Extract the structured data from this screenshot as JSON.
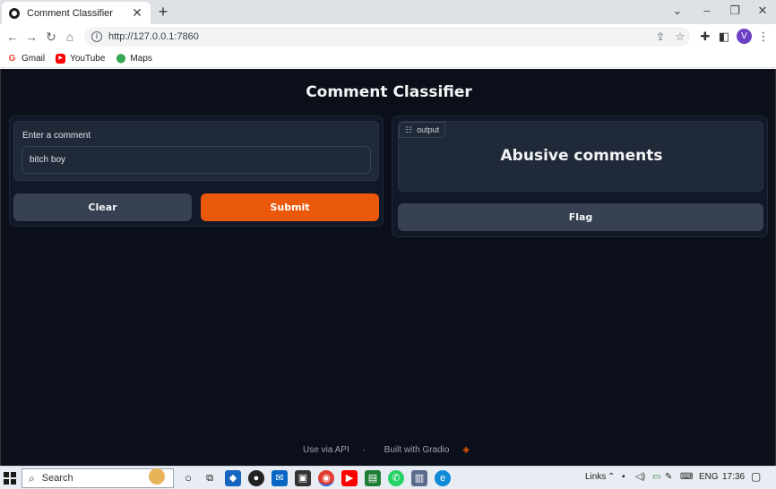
{
  "browser": {
    "tab_title": "Comment Classifier",
    "tab_close": "✕",
    "new_tab": "+",
    "url": "http://127.0.0.1:7860",
    "profile_initial": "V",
    "bookmarks": [
      {
        "label": "Gmail",
        "icon": "gmail-icon"
      },
      {
        "label": "YouTube",
        "icon": "youtube-icon"
      },
      {
        "label": "Maps",
        "icon": "maps-icon"
      }
    ]
  },
  "app": {
    "title": "Comment Classifier",
    "input": {
      "label": "Enter a comment",
      "value": "bitch boy"
    },
    "buttons": {
      "clear": "Clear",
      "submit": "Submit",
      "flag": "Flag"
    },
    "output": {
      "tag": "output",
      "value": "Abusive comments"
    },
    "footer": {
      "api": "Use via API",
      "separator": "·",
      "built": "Built with Gradio"
    },
    "colors": {
      "background": "#0b0f19",
      "panel": "#1f2937",
      "submit": "#ea580c",
      "secondary_button": "#374151"
    }
  },
  "taskbar": {
    "search_label": "Search",
    "links_label": "Links",
    "language": "ENG",
    "time": "17:36"
  }
}
